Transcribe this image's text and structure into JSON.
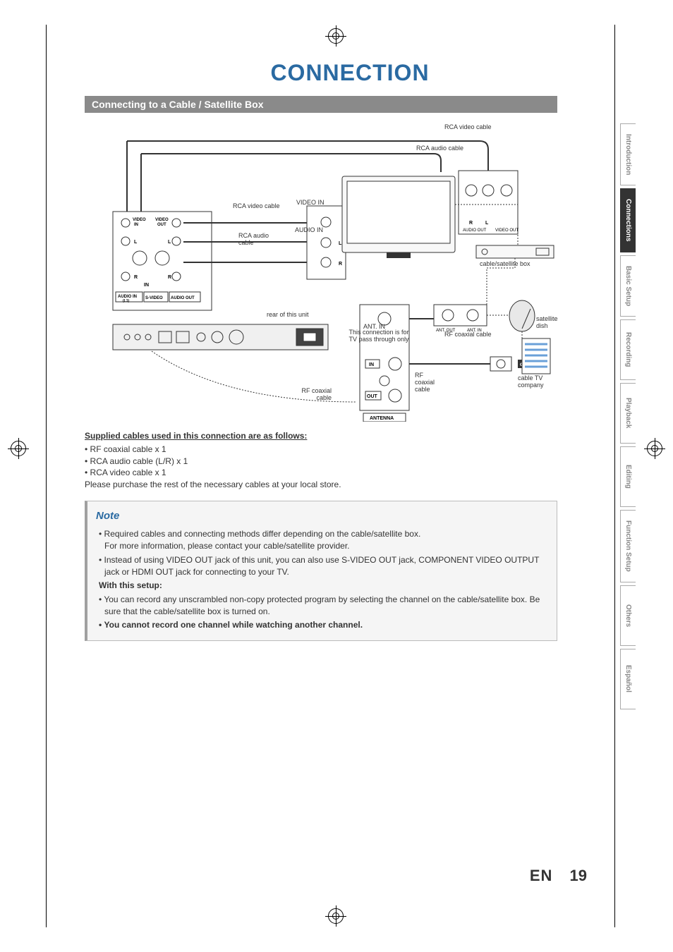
{
  "title": "CONNECTION",
  "section": "Connecting to a Cable / Satellite Box",
  "diagram": {
    "rca_video_cable_top": "RCA video cable",
    "rca_audio_cable_top": "RCA audio  cable",
    "video_in_lbl": "VIDEO IN",
    "video_out_lbl": "VIDEO OUT",
    "r_lbl": "R",
    "l_lbl": "L",
    "in_lbl": "IN",
    "out_lbl": "OUT",
    "audio_in_l1": "AUDIO IN (L1)",
    "s_video": "S-VIDEO",
    "audio_out_lbl": "AUDIO OUT",
    "rca_video_cable": "RCA video cable",
    "rca_audio_cable": "RCA audio cable",
    "video_in": "VIDEO IN",
    "audio_in": "AUDIO IN",
    "rear_of_unit": "rear of this unit",
    "ant_in": "ANT. IN",
    "ant_out": "ANT. OUT",
    "pass_through": "This connection is for TV pass through only",
    "rf_coaxial_cable": "RF coaxial cable",
    "antenna": "ANTENNA",
    "cable_sat_box": "cable/satellite box",
    "audio_out_rl": "AUDIO OUT",
    "video_out_rl": "VIDEO OUT",
    "satellite_dish": "satellite dish",
    "or": "or",
    "cable_tv_company": "cable TV company"
  },
  "supplied": {
    "heading": "Supplied cables used in this connection are as follows:",
    "items": [
      "RF coaxial cable x 1",
      "RCA audio cable (L/R) x 1",
      "RCA video cable x 1"
    ],
    "purchase": "Please purchase the rest of the necessary cables at your local store."
  },
  "note": {
    "title": "Note",
    "line1": "Required cables and connecting methods differ depending on the cable/satellite box.",
    "line1b": "For more information, please contact your cable/satellite provider.",
    "line2": "Instead of using VIDEO OUT jack of this unit, you can also use S-VIDEO OUT jack, COMPONENT VIDEO OUTPUT jack or HDMI OUT jack for connecting to your TV.",
    "with_setup": "With this setup:",
    "line3": "You can record any unscrambled non-copy protected program by selecting the channel on the cable/satellite box. Be sure that the cable/satellite box is turned on.",
    "line4": "You cannot record one channel while watching another channel."
  },
  "tabs": [
    {
      "label": "Introduction",
      "active": false
    },
    {
      "label": "Connections",
      "active": true
    },
    {
      "label": "Basic Setup",
      "active": false
    },
    {
      "label": "Recording",
      "active": false
    },
    {
      "label": "Playback",
      "active": false
    },
    {
      "label": "Editing",
      "active": false
    },
    {
      "label": "Function Setup",
      "active": false
    },
    {
      "label": "Others",
      "active": false
    },
    {
      "label": "Español",
      "active": false
    }
  ],
  "footer": {
    "lang": "EN",
    "page": "19"
  }
}
